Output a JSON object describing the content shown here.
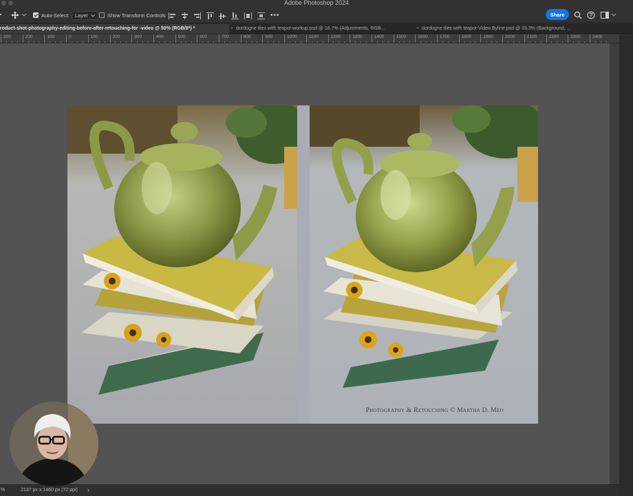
{
  "window": {
    "title": "Adobe Photoshop 2024"
  },
  "options_bar": {
    "auto_select_label": "Auto-Select:",
    "auto_select_checked": true,
    "layer_select_value": "Layer",
    "transform_controls_label": "Show Transform Controls",
    "transform_controls_checked": false,
    "more_label": "•••",
    "share_label": "Share"
  },
  "tabs": [
    {
      "label": "roduct-shot-photography-editing-before-after-retouching-for -video @ 50% (RGB/8*) *",
      "active": true
    },
    {
      "label": "dordogne tiles with teapot-workup.psd @ 16.7% (Adjustments, RGB...",
      "active": false
    },
    {
      "label": "dordogne tiles with teapot-Video Byline.psd @ 33.3% (Background, ...",
      "active": false
    }
  ],
  "ruler": {
    "labels": [
      "300",
      "200",
      "100",
      "0",
      "100",
      "200",
      "300",
      "400",
      "500",
      "600",
      "700",
      "800",
      "900",
      "1000",
      "1100",
      "1200",
      "1300",
      "1400",
      "1500",
      "1600",
      "1700",
      "1800",
      "1900",
      "2000",
      "2100",
      "2200",
      "2300",
      "2400"
    ]
  },
  "document": {
    "byline": "Photography & Retouching © Martha D. Meo"
  },
  "status_bar": {
    "zoom": "%",
    "dimensions": "2137 px x 1460 px (72 ppi)",
    "arrow": "›"
  },
  "icons": {
    "move_tool": "move-icon",
    "search": "search-icon",
    "help": "help-icon",
    "workspace": "workspace-icon"
  },
  "colors": {
    "accent": "#1473e6",
    "canvas_bg": "#535353",
    "ui_bg": "#323232"
  }
}
